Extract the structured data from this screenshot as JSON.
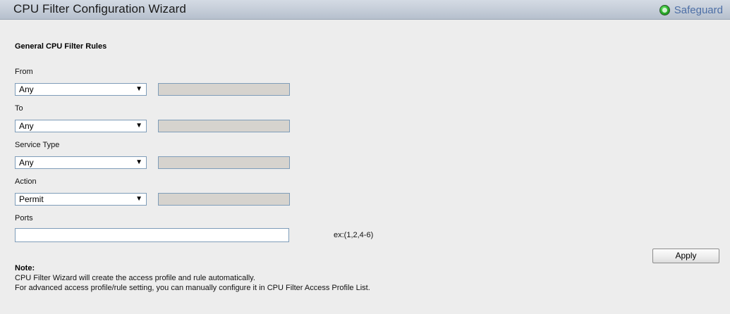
{
  "header": {
    "title": "CPU Filter Configuration Wizard",
    "safeguard_label": "Safeguard",
    "safeguard_color": "#2fb52f"
  },
  "form": {
    "section_title": "General CPU Filter Rules",
    "from": {
      "label": "From",
      "value": "Any"
    },
    "to": {
      "label": "To",
      "value": "Any"
    },
    "service_type": {
      "label": "Service Type",
      "value": "Any"
    },
    "action": {
      "label": "Action",
      "value": "Permit"
    },
    "ports": {
      "label": "Ports",
      "value": "",
      "hint": "ex:(1,2,4-6)"
    },
    "apply_label": "Apply"
  },
  "note": {
    "title": "Note:",
    "lines": [
      "CPU Filter Wizard will create the access profile and rule automatically.",
      "For advanced access profile/rule setting, you can manually configure it in CPU Filter Access Profile List."
    ]
  }
}
